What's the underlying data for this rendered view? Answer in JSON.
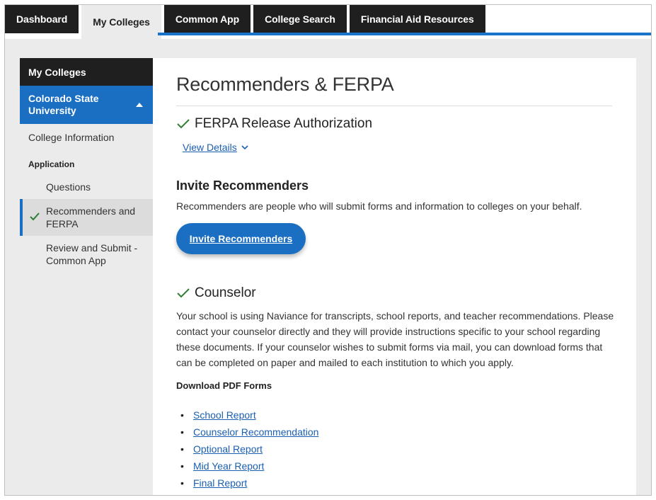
{
  "tabs": [
    {
      "label": "Dashboard",
      "active": false
    },
    {
      "label": "My Colleges",
      "active": true
    },
    {
      "label": "Common App",
      "active": false
    },
    {
      "label": "College Search",
      "active": false
    },
    {
      "label": "Financial Aid Resources",
      "active": false
    }
  ],
  "sidebar": {
    "header": "My Colleges",
    "college": "Colorado State University",
    "items": {
      "college_info": "College Information",
      "application": "Application",
      "questions": "Questions",
      "recommenders": "Recommenders and FERPA",
      "review": "Review and Submit - Common App"
    }
  },
  "main": {
    "title": "Recommenders & FERPA",
    "ferpa": {
      "heading": "FERPA Release Authorization",
      "view_details": "View Details"
    },
    "invite": {
      "heading": "Invite Recommenders",
      "description": "Recommenders are people who will submit forms and information to colleges on your behalf.",
      "button": "Invite Recommenders"
    },
    "counselor": {
      "heading": "Counselor",
      "description": "Your school is using Naviance for transcripts, school reports, and teacher recommendations. Please contact your counselor directly and they will provide instructions specific to your school regarding these documents. If your counselor wishes to submit forms via mail, you can download forms that can be completed on paper and mailed to each institution to which you apply.",
      "download_title": "Download PDF Forms",
      "forms": [
        "School Report",
        "Counselor Recommendation",
        "Optional Report",
        "Mid Year Report",
        "Final Report"
      ]
    }
  },
  "colors": {
    "accent": "#1a6fc2",
    "check": "#2e7d32",
    "dark": "#1f1f1f"
  }
}
